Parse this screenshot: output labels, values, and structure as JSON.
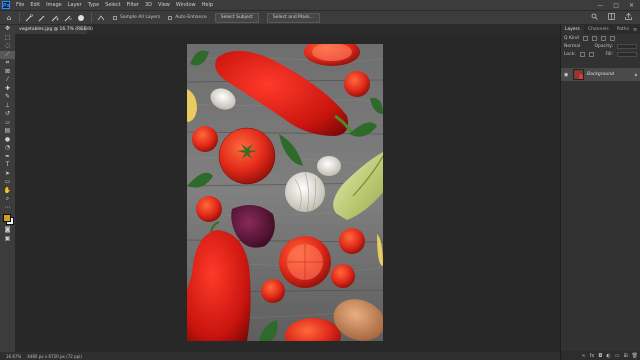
{
  "menubar": {
    "logo": "Ps",
    "items": [
      "File",
      "Edit",
      "Image",
      "Layer",
      "Type",
      "Select",
      "Filter",
      "3D",
      "View",
      "Window",
      "Help"
    ],
    "controls": [
      "—",
      "□",
      "✕"
    ]
  },
  "options": {
    "tool_glyph": "⌂",
    "sample_all_layers": "Sample All Layers",
    "auto_enhance": "Auto-Enhance",
    "select_subject": "Select Subject",
    "select_and_mask": "Select and Mask..."
  },
  "document": {
    "tab_label": "vegetables.jpg @ 16.7% (RGB/8)",
    "close": "×"
  },
  "status": {
    "zoom": "16.67%",
    "info": "4480 px x 6720 px (72 ppi)"
  },
  "panel": {
    "tabs": [
      "Layers",
      "Channels",
      "Paths"
    ],
    "kind_label": "Q Kind",
    "blend": "Normal",
    "opacity_label": "Opacity:",
    "lock_label": "Lock:",
    "fill_label": "Fill:",
    "layer_name": "Background"
  },
  "colors": {
    "accent": "#2f8fff",
    "foreground": "#d0a020",
    "background": "#f0f0f0",
    "ui_bg": "#282828"
  }
}
